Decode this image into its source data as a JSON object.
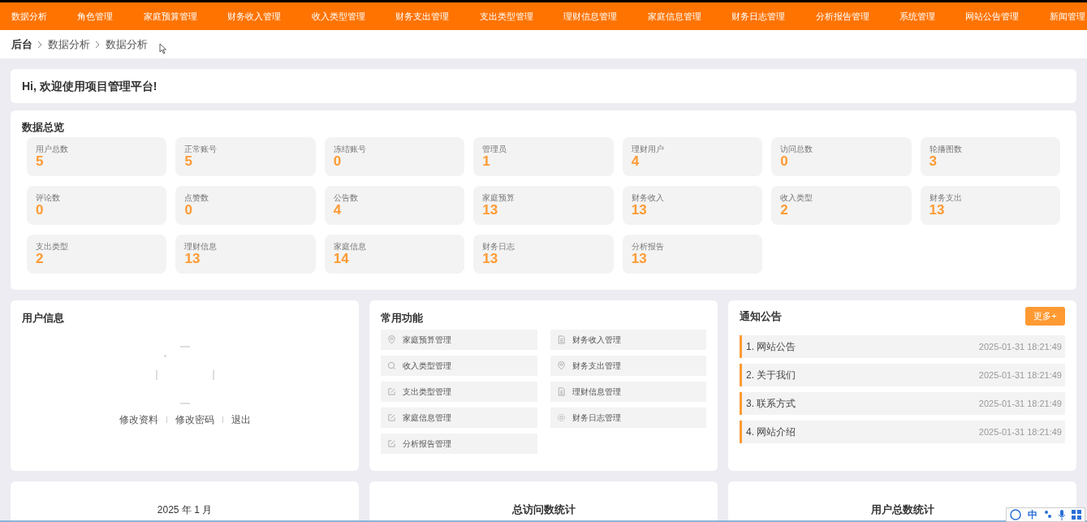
{
  "nav": [
    "数据分析",
    "角色管理",
    "家庭预算管理",
    "财务收入管理",
    "收入类型管理",
    "财务支出管理",
    "支出类型管理",
    "理财信息管理",
    "家庭信息管理",
    "财务日志管理",
    "分析报告管理",
    "系统管理",
    "网站公告管理",
    "新闻管理"
  ],
  "breadcrumb": [
    "后台",
    "数据分析",
    "数据分析"
  ],
  "welcome": "Hi, 欢迎使用项目管理平台!",
  "overview": {
    "title": "数据总览",
    "stats": [
      {
        "label": "用户总数",
        "value": "5"
      },
      {
        "label": "正常账号",
        "value": "5"
      },
      {
        "label": "冻结账号",
        "value": "0"
      },
      {
        "label": "管理员",
        "value": "1"
      },
      {
        "label": "理财用户",
        "value": "4"
      },
      {
        "label": "访问总数",
        "value": "0"
      },
      {
        "label": "轮播图数",
        "value": "3"
      },
      {
        "label": "评论数",
        "value": "0"
      },
      {
        "label": "点赞数",
        "value": "0"
      },
      {
        "label": "公告数",
        "value": "4"
      },
      {
        "label": "家庭预算",
        "value": "13"
      },
      {
        "label": "财务收入",
        "value": "13"
      },
      {
        "label": "收入类型",
        "value": "2"
      },
      {
        "label": "财务支出",
        "value": "13"
      },
      {
        "label": "支出类型",
        "value": "2"
      },
      {
        "label": "理财信息",
        "value": "13"
      },
      {
        "label": "家庭信息",
        "value": "14"
      },
      {
        "label": "财务日志",
        "value": "13"
      },
      {
        "label": "分析报告",
        "value": "13"
      }
    ]
  },
  "user_info": {
    "title": "用户信息",
    "links": [
      "修改资料",
      "修改密码",
      "退出"
    ]
  },
  "shortcuts": {
    "title": "常用功能",
    "items": [
      {
        "label": "家庭预算管理",
        "kind": "pin"
      },
      {
        "label": "财务收入管理",
        "kind": "document"
      },
      {
        "label": "收入类型管理",
        "kind": "search"
      },
      {
        "label": "财务支出管理",
        "kind": "pin"
      },
      {
        "label": "支出类型管理",
        "kind": "edit"
      },
      {
        "label": "理财信息管理",
        "kind": "document"
      },
      {
        "label": "家庭信息管理",
        "kind": "edit"
      },
      {
        "label": "财务日志管理",
        "kind": "gear"
      },
      {
        "label": "分析报告管理",
        "kind": "edit"
      }
    ]
  },
  "notices": {
    "title": "通知公告",
    "more": "更多+",
    "items": [
      {
        "title": "1. 网站公告",
        "time": "2025-01-31 18:21:49"
      },
      {
        "title": "2. 关于我们",
        "time": "2025-01-31 18:21:49"
      },
      {
        "title": "3. 联系方式",
        "time": "2025-01-31 18:21:49"
      },
      {
        "title": "4. 网站介绍",
        "time": "2025-01-31 18:21:49"
      }
    ]
  },
  "bottom_cards": [
    "2025 年 1 月",
    "总访问数统计",
    "用户总数统计"
  ],
  "ime_toolbar": {
    "mode": "中"
  }
}
